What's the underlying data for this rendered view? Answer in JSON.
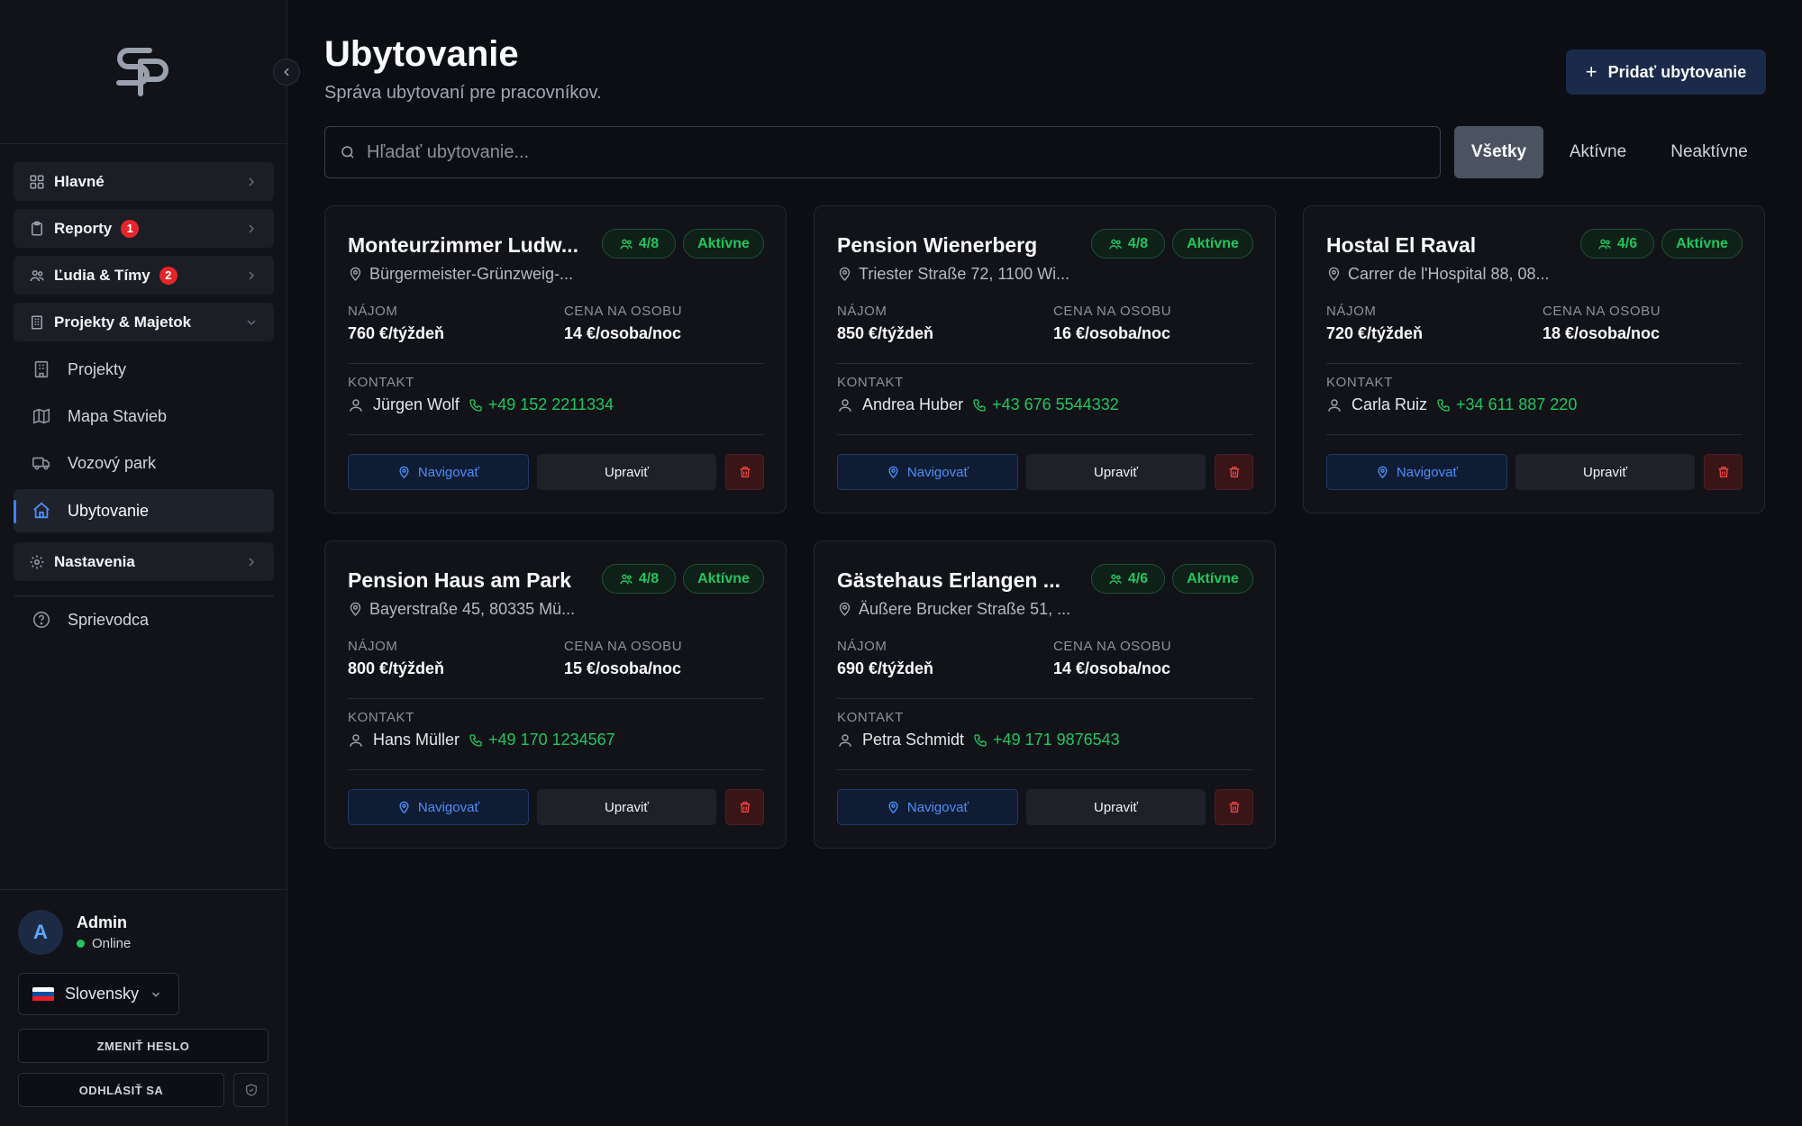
{
  "sidebar": {
    "groups": {
      "hlavne": "Hlavné",
      "reporty": "Reporty",
      "reporty_badge": "1",
      "ludia": "Ľudia & Tímy",
      "ludia_badge": "2",
      "projekty_majetok": "Projekty & Majetok",
      "nastavenia": "Nastavenia"
    },
    "sub_items": {
      "projekty": "Projekty",
      "mapa": "Mapa Stavieb",
      "vozovy": "Vozový park",
      "ubytovanie": "Ubytovanie",
      "sprievodca": "Sprievodca"
    },
    "user": {
      "initial": "A",
      "name": "Admin",
      "status": "Online"
    },
    "language": "Slovensky",
    "change_password": "ZMENIŤ HESLO",
    "logout": "ODHLÁSIŤ SA"
  },
  "header": {
    "title": "Ubytovanie",
    "subtitle": "Správa ubytovaní pre pracovníkov.",
    "add_button": "Pridať ubytovanie",
    "add_plus": "+"
  },
  "search": {
    "placeholder": "Hľadať ubytovanie..."
  },
  "filters": {
    "all": "Všetky",
    "active": "Aktívne",
    "inactive": "Neaktívne"
  },
  "labels": {
    "rent": "NÁJOM",
    "price_per_person": "CENA NA OSOBU",
    "contact": "KONTAKT",
    "navigate": "Navigovať",
    "edit": "Upraviť"
  },
  "cards": [
    {
      "name": "Monteurzimmer Ludw...",
      "occupancy": "4/8",
      "status": "Aktívne",
      "address": "Bürgermeister-Grünzweig-...",
      "rent": "760 €/týždeň",
      "price": "14 €/osoba/noc",
      "contact_name": "Jürgen Wolf",
      "phone": "+49 152 2211334"
    },
    {
      "name": "Pension Wienerberg",
      "occupancy": "4/8",
      "status": "Aktívne",
      "address": "Triester Straße 72, 1100 Wi...",
      "rent": "850 €/týždeň",
      "price": "16 €/osoba/noc",
      "contact_name": "Andrea Huber",
      "phone": "+43 676 5544332"
    },
    {
      "name": "Hostal El Raval",
      "occupancy": "4/6",
      "status": "Aktívne",
      "address": "Carrer de l'Hospital 88, 08...",
      "rent": "720 €/týždeň",
      "price": "18 €/osoba/noc",
      "contact_name": "Carla Ruiz",
      "phone": "+34 611 887 220"
    },
    {
      "name": "Pension Haus am Park",
      "occupancy": "4/8",
      "status": "Aktívne",
      "address": "Bayerstraße 45, 80335 Mü...",
      "rent": "800 €/týždeň",
      "price": "15 €/osoba/noc",
      "contact_name": "Hans Müller",
      "phone": "+49 170 1234567"
    },
    {
      "name": "Gästehaus Erlangen ...",
      "occupancy": "4/6",
      "status": "Aktívne",
      "address": "Äußere Brucker Straße 51, ...",
      "rent": "690 €/týždeň",
      "price": "14 €/osoba/noc",
      "contact_name": "Petra Schmidt",
      "phone": "+49 171 9876543"
    }
  ],
  "colors": {
    "accent": "#3b82f6",
    "success": "#22c55e",
    "danger": "#ef4444",
    "badge": "#e5252a"
  }
}
